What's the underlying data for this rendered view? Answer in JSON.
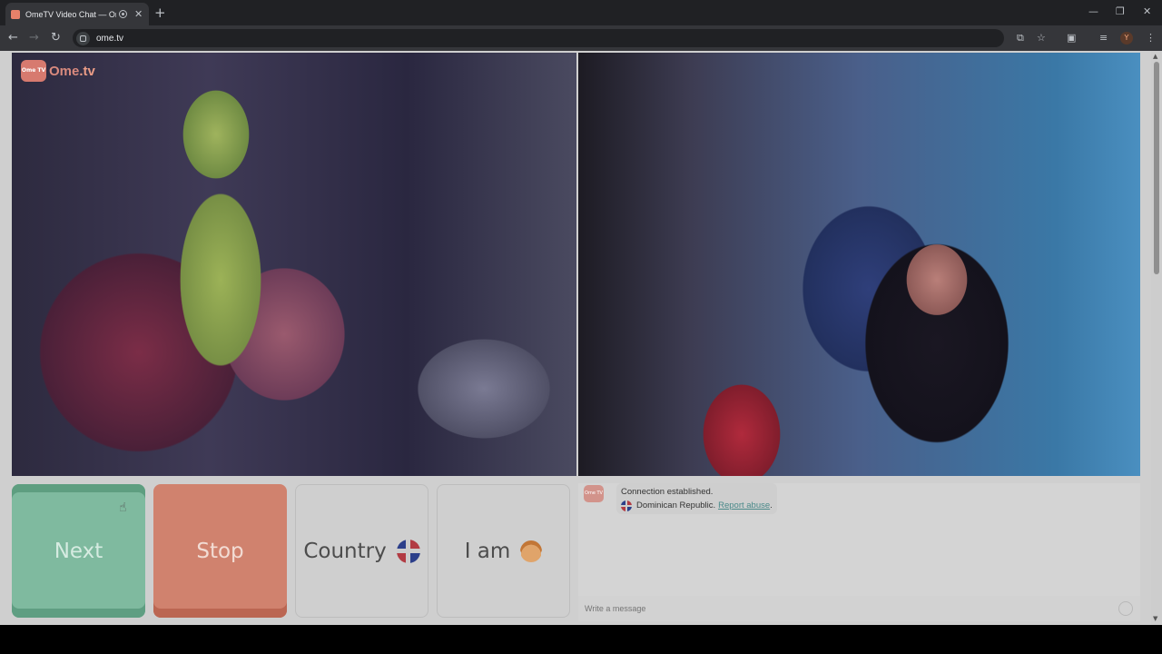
{
  "browser": {
    "tab_title": "OmeTV Video Chat — Ome",
    "url": "ome.tv",
    "profile_initial": "Y"
  },
  "page": {
    "logo_text_ome": "Ome",
    "logo_text_tv": ".tv",
    "logo_badge": "Ome TV",
    "buttons": {
      "next": "Next",
      "stop": "Stop",
      "country": "Country",
      "iam": "I am"
    },
    "chat": {
      "status": "Connection established.",
      "country": "Dominican Republic.",
      "report": "Report abuse",
      "report_suffix": ".",
      "input_placeholder": "Write a message"
    }
  },
  "colors": {
    "next": "#7fba9f",
    "stop": "#d0826e",
    "brand": "#d77a6f"
  }
}
